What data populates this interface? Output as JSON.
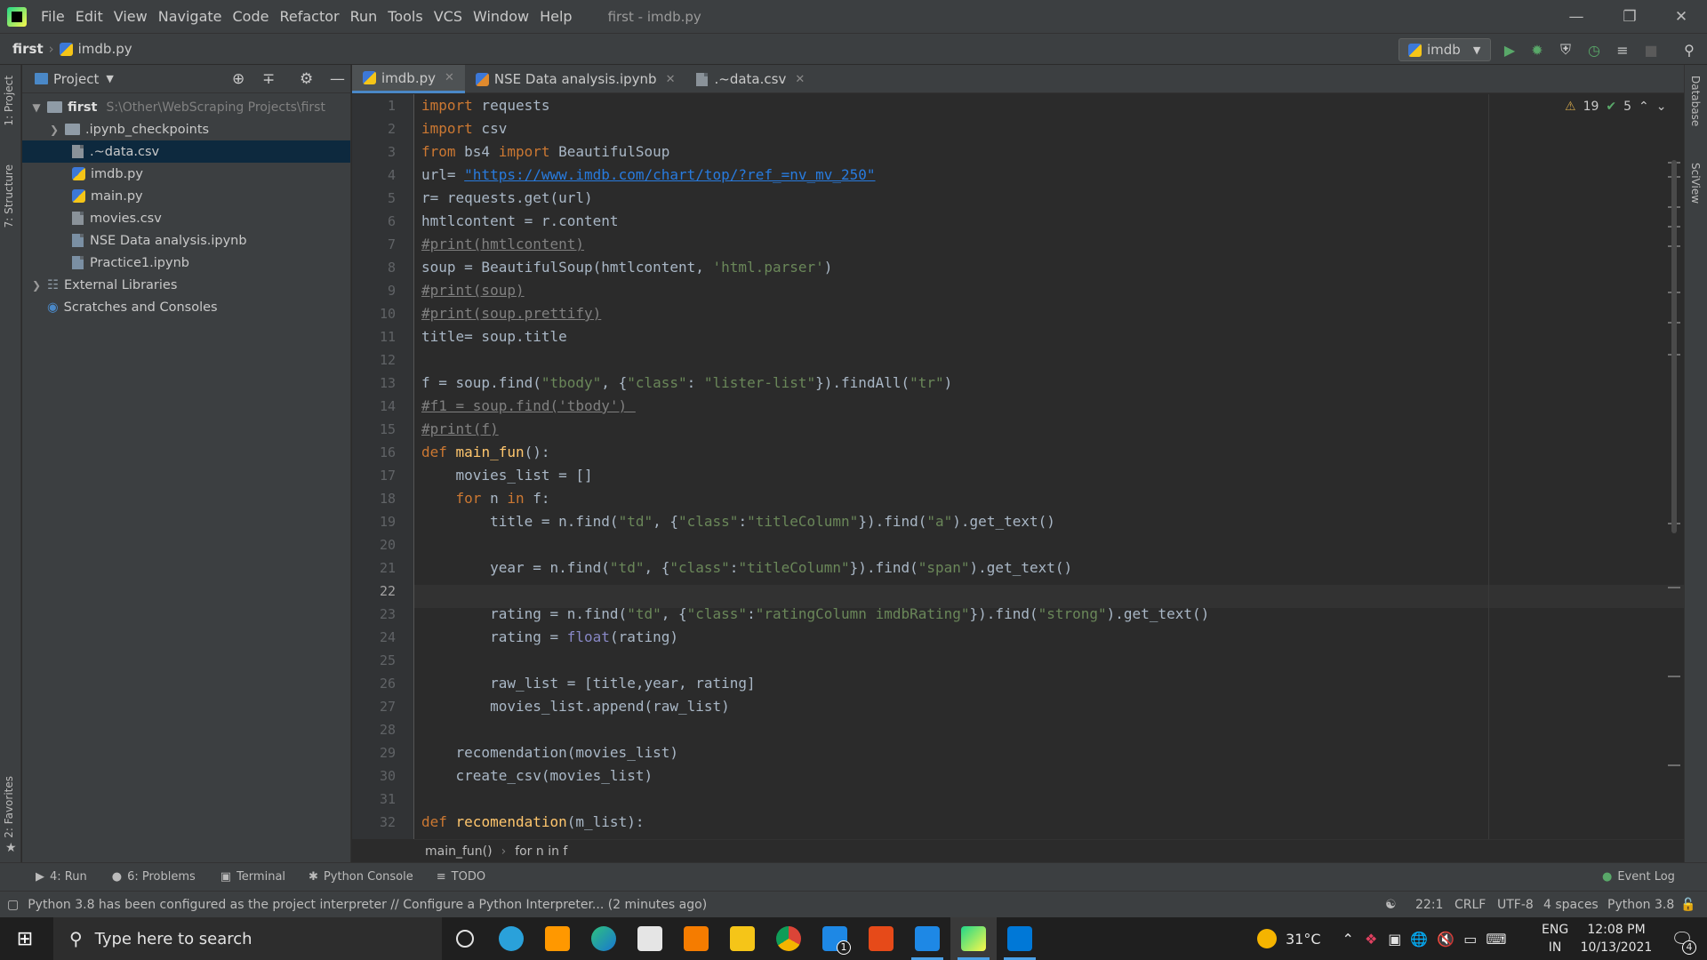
{
  "menubar": {
    "items": [
      "File",
      "Edit",
      "View",
      "Navigate",
      "Code",
      "Refactor",
      "Run",
      "Tools",
      "VCS",
      "Window",
      "Help"
    ],
    "title": "first - imdb.py"
  },
  "navbar": {
    "project": "first",
    "file": "imdb.py",
    "run_config": "imdb"
  },
  "side_tools": {
    "project": "1: Project",
    "structure": "7: Structure",
    "favorites": "2: Favorites",
    "database": "Database",
    "sciview": "SciView"
  },
  "project_panel": {
    "title": "Project",
    "root": {
      "name": "first",
      "path": "S:\\Other\\WebScraping Projects\\first"
    },
    "items": [
      ".ipynb_checkpoints",
      ".~data.csv",
      "imdb.py",
      "main.py",
      "movies.csv",
      "NSE Data analysis.ipynb",
      "Practice1.ipynb"
    ],
    "external": "External Libraries",
    "scratches": "Scratches and Consoles"
  },
  "tabs": [
    "imdb.py",
    "NSE Data analysis.ipynb",
    ".~data.csv"
  ],
  "inspections": {
    "warnings": "19",
    "ok": "5"
  },
  "code": {
    "l1": [
      "import",
      " requests"
    ],
    "l2": [
      "import",
      " csv"
    ],
    "l3": [
      "from",
      " bs4 ",
      "import",
      " BeautifulSoup"
    ],
    "l4": [
      "url= ",
      "\"https://www.imdb.com/chart/top/?ref_=nv_mv_250\""
    ],
    "l5": "r= requests.get(url)",
    "l6": "hmtlcontent = r.content",
    "l7": "#print(hmtlcontent)",
    "l8": [
      "soup = BeautifulSoup(hmtlcontent, ",
      "'html.parser'",
      ")"
    ],
    "l9": "#print(soup)",
    "l10": "#print(soup.prettify)",
    "l11": "title= soup.title",
    "l13": [
      "f = soup.find(",
      "\"tbody\"",
      ", {",
      "\"class\"",
      ": ",
      "\"lister-list\"",
      "}).findAll(",
      "\"tr\"",
      ")"
    ],
    "l14": "#f1 = soup.find('tbody') ",
    "l15": "#print(f)",
    "l16": [
      "def",
      " main_fun",
      "():"
    ],
    "l17": "    movies_list = []",
    "l18": [
      "    ",
      "for",
      " n ",
      "in",
      " f:"
    ],
    "l19": [
      "        title = n.find(",
      "\"td\"",
      ", {",
      "\"class\"",
      ":",
      "\"titleColumn\"",
      "}).find(",
      "\"a\"",
      ").get_text()"
    ],
    "l21": [
      "        year = n.find(",
      "\"td\"",
      ", {",
      "\"class\"",
      ":",
      "\"titleColumn\"",
      "}).find(",
      "\"span\"",
      ").get_text()"
    ],
    "l23": [
      "        rating = n.find(",
      "\"td\"",
      ", {",
      "\"class\"",
      ":",
      "\"ratingColumn imdbRating\"",
      "}).find(",
      "\"strong\"",
      ").get_text()"
    ],
    "l24": [
      "        rating = ",
      "float",
      "(rating)"
    ],
    "l26": "        raw_list = [title,year, rating]",
    "l27": "        movies_list.append(raw_list)",
    "l29": "    recomendation(movies_list)",
    "l30": "    create_csv(movies_list)",
    "l32": [
      "def",
      " recomendation",
      "(m_list):"
    ]
  },
  "line_numbers": [
    "1",
    "2",
    "3",
    "4",
    "5",
    "6",
    "7",
    "8",
    "9",
    "10",
    "11",
    "12",
    "13",
    "14",
    "15",
    "16",
    "17",
    "18",
    "19",
    "20",
    "21",
    "22",
    "23",
    "24",
    "25",
    "26",
    "27",
    "28",
    "29",
    "30",
    "31",
    "32"
  ],
  "editor_breadcrumb": [
    "main_fun()",
    "for n in f"
  ],
  "tool_windows": [
    "4: Run",
    "6: Problems",
    "Terminal",
    "Python Console",
    "TODO"
  ],
  "event_log": "Event Log",
  "status": {
    "message": "Python 3.8 has been configured as the project interpreter // Configure a Python Interpreter... (2 minutes ago)",
    "position": "22:1",
    "line_sep": "CRLF",
    "encoding": "UTF-8",
    "indent": "4 spaces",
    "interpreter": "Python 3.8"
  },
  "taskbar": {
    "search_placeholder": "Type here to search",
    "weather": "31°C",
    "lang1": "ENG",
    "lang2": "IN",
    "time": "12:08 PM",
    "date": "10/13/2021",
    "notif_count": "4",
    "mail_badge": "1"
  }
}
